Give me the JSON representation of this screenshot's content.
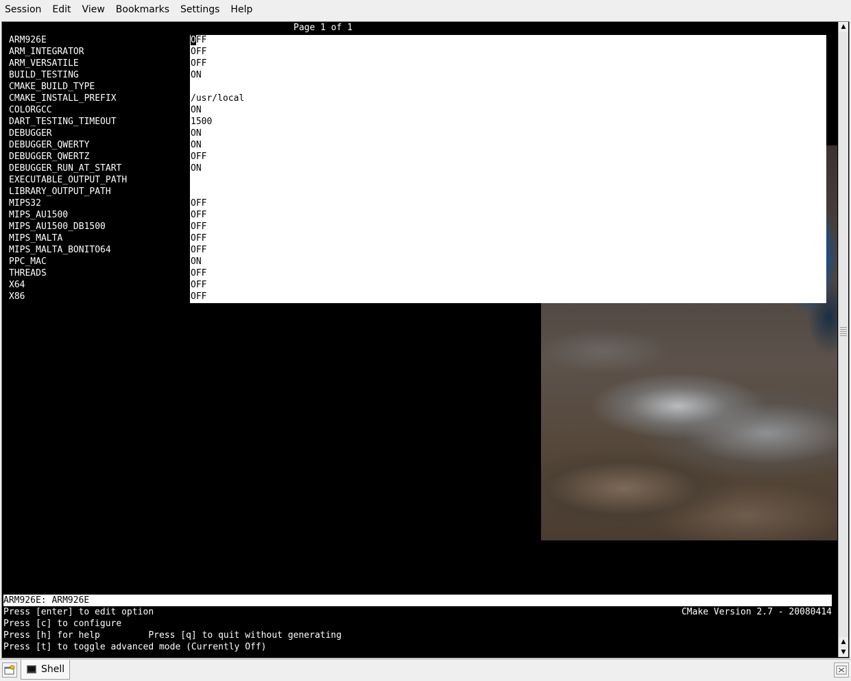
{
  "menubar": {
    "items": [
      "Session",
      "Edit",
      "View",
      "Bookmarks",
      "Settings",
      "Help"
    ]
  },
  "terminal": {
    "page_title": "Page 1 of 1",
    "options": [
      {
        "name": "ARM926E",
        "value": "OFF"
      },
      {
        "name": "ARM_INTEGRATOR",
        "value": "OFF"
      },
      {
        "name": "ARM_VERSATILE",
        "value": "OFF"
      },
      {
        "name": "BUILD_TESTING",
        "value": "ON"
      },
      {
        "name": "CMAKE_BUILD_TYPE",
        "value": ""
      },
      {
        "name": "CMAKE_INSTALL_PREFIX",
        "value": "/usr/local"
      },
      {
        "name": "COLORGCC",
        "value": "ON"
      },
      {
        "name": "DART_TESTING_TIMEOUT",
        "value": "1500"
      },
      {
        "name": "DEBUGGER",
        "value": "ON"
      },
      {
        "name": "DEBUGGER_QWERTY",
        "value": "ON"
      },
      {
        "name": "DEBUGGER_QWERTZ",
        "value": "OFF"
      },
      {
        "name": "DEBUGGER_RUN_AT_START",
        "value": "ON"
      },
      {
        "name": "EXECUTABLE_OUTPUT_PATH",
        "value": ""
      },
      {
        "name": "LIBRARY_OUTPUT_PATH",
        "value": ""
      },
      {
        "name": "MIPS32",
        "value": "OFF"
      },
      {
        "name": "MIPS_AU1500",
        "value": "OFF"
      },
      {
        "name": "MIPS_AU1500_DB1500",
        "value": "OFF"
      },
      {
        "name": "MIPS_MALTA",
        "value": "OFF"
      },
      {
        "name": "MIPS_MALTA_BONITO64",
        "value": "OFF"
      },
      {
        "name": "PPC_MAC",
        "value": "ON"
      },
      {
        "name": "THREADS",
        "value": "OFF"
      },
      {
        "name": "X64",
        "value": "OFF"
      },
      {
        "name": "X86",
        "value": "OFF"
      }
    ],
    "status_line": "ARM926E: ARM926E",
    "help_lines": [
      "Press [enter] to edit option",
      "Press [c] to configure",
      "Press [h] for help         Press [q] to quit without generating",
      "Press [t] to toggle advanced mode (Currently Off)"
    ],
    "version": "CMake Version 2.7 - 20080414"
  },
  "tabbar": {
    "tabs": [
      {
        "label": "Shell"
      }
    ]
  },
  "icons": {
    "new_tab": "new-tab-icon",
    "close_tab": "close-tab-icon",
    "terminal": "terminal-icon"
  }
}
